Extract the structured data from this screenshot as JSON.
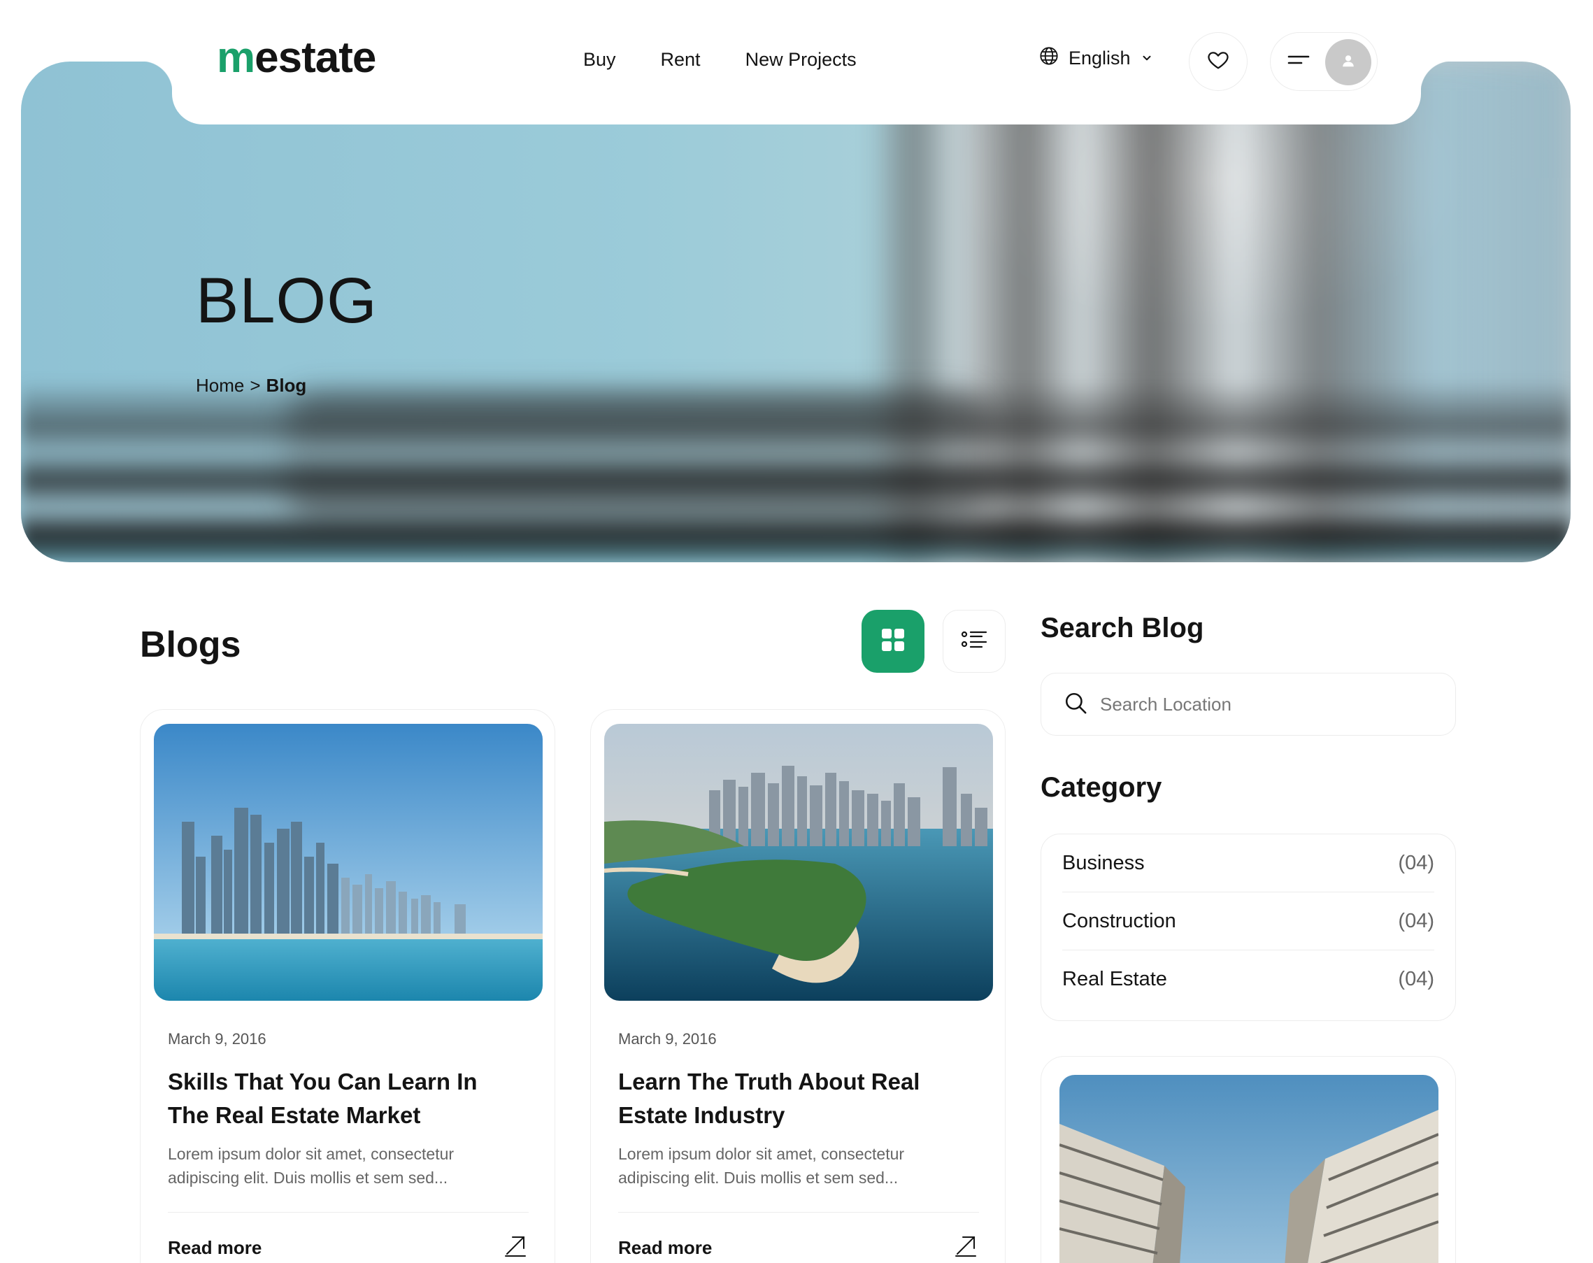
{
  "header": {
    "logo": "mestate",
    "nav": [
      "Buy",
      "Rent",
      "New Projects"
    ],
    "language": "English"
  },
  "hero": {
    "title": "BLOG",
    "breadcrumb": {
      "home": "Home",
      "separator": ">",
      "current": "Blog"
    }
  },
  "main": {
    "title": "Blogs",
    "posts": [
      {
        "date": "March 9, 2016",
        "title": "Skills That You Can Learn In The Real Estate Market",
        "excerpt": "Lorem ipsum dolor sit amet, consectetur adipiscing elit. Duis mollis et sem sed...",
        "read_more": "Read more"
      },
      {
        "date": "March 9, 2016",
        "title": "Learn The Truth About Real Estate Industry",
        "excerpt": "Lorem ipsum dolor sit amet, consectetur adipiscing elit. Duis mollis et sem sed...",
        "read_more": "Read more"
      }
    ]
  },
  "sidebar": {
    "search_title": "Search Blog",
    "search_placeholder": "Search Location",
    "category_title": "Category",
    "categories": [
      {
        "label": "Business",
        "count": "(04)"
      },
      {
        "label": "Construction",
        "count": "(04)"
      },
      {
        "label": "Real Estate",
        "count": "(04)"
      }
    ]
  },
  "colors": {
    "accent": "#1aa06a",
    "text": "#141414",
    "muted": "#666666"
  },
  "icons": [
    "globe-icon",
    "chevron-down-icon",
    "heart-icon",
    "menu-icon",
    "user-icon",
    "grid-icon",
    "list-icon",
    "search-icon",
    "arrow-up-right-icon"
  ]
}
